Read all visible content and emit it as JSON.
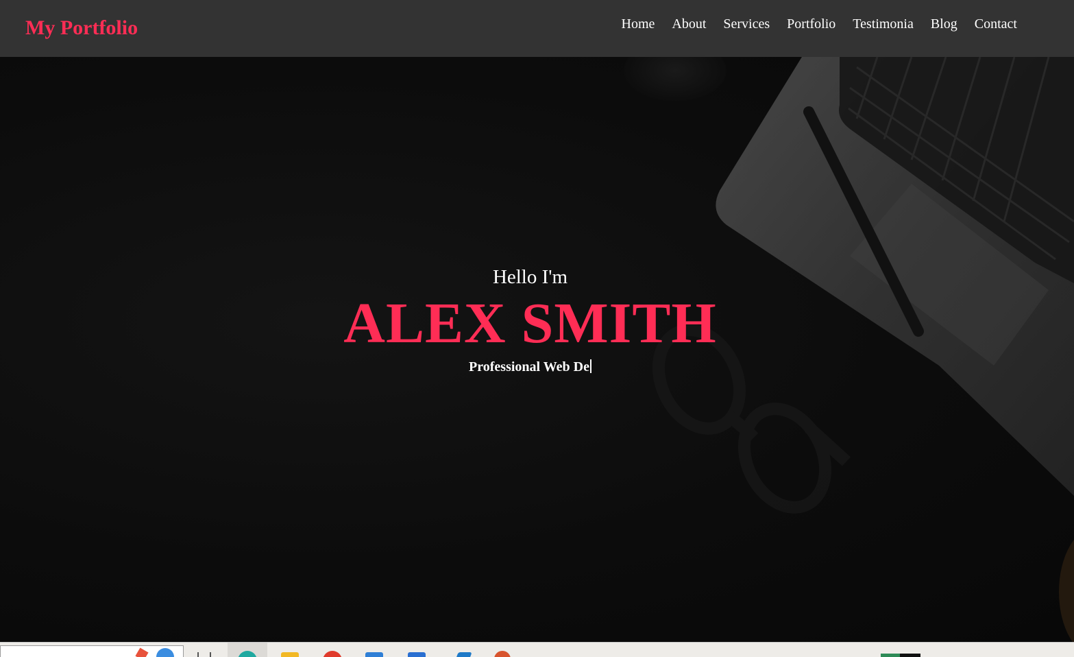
{
  "header": {
    "brand": "My Portfolio",
    "nav_items": [
      {
        "label": "Home"
      },
      {
        "label": "About"
      },
      {
        "label": "Services"
      },
      {
        "label": "Portfolio"
      },
      {
        "label": "Testimonia"
      },
      {
        "label": "Blog"
      },
      {
        "label": "Contact"
      }
    ]
  },
  "hero": {
    "greeting": "Hello I'm",
    "name": "ALEX SMITH",
    "tagline": "Professional Web De"
  },
  "colors": {
    "accent": "#ff2d55",
    "navbar_bg": "#333333",
    "hero_bg": "#0c0c0c",
    "text": "#ffffff"
  },
  "taskbar": {
    "icons": [
      "search-box",
      "task-view-icon",
      "edge-icon",
      "file-explorer-icon",
      "chrome-icon",
      "store-icon",
      "mail-icon",
      "vscode-icon",
      "app-icon"
    ]
  }
}
